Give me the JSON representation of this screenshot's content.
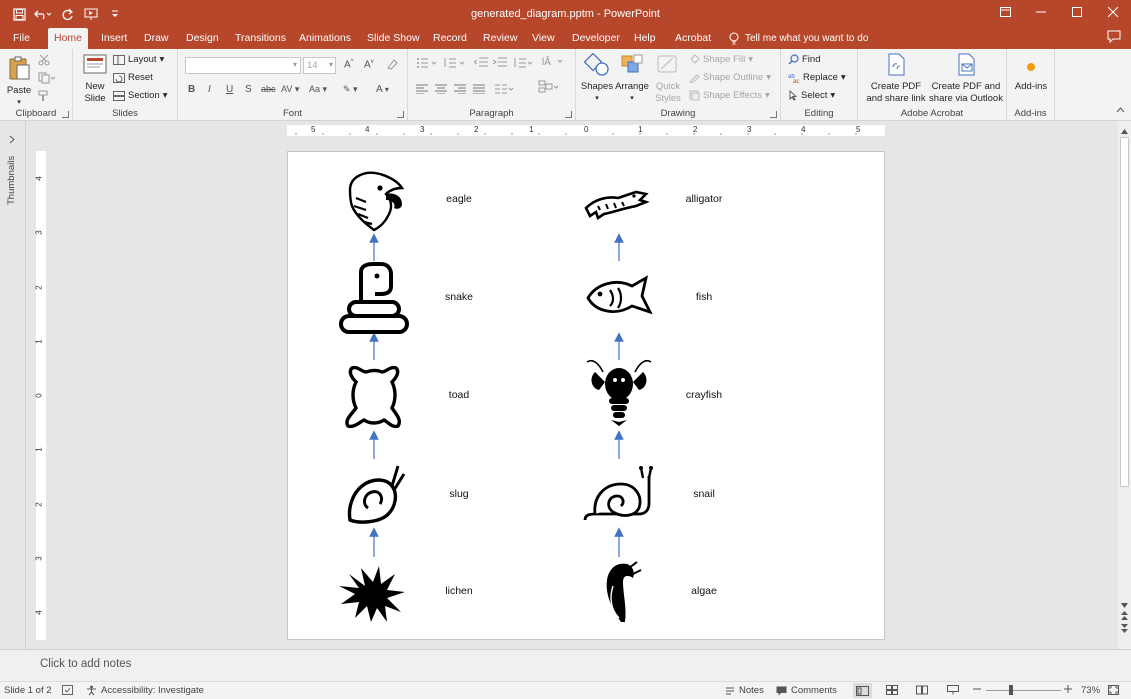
{
  "titlebar": {
    "document_title": "generated_diagram.pptm - PowerPoint"
  },
  "tabs": [
    "File",
    "Home",
    "Insert",
    "Draw",
    "Design",
    "Transitions",
    "Animations",
    "Slide Show",
    "Record",
    "Review",
    "View",
    "Developer",
    "Help",
    "Acrobat"
  ],
  "active_tab": "Home",
  "tell_me": "Tell me what you want to do",
  "ribbon": {
    "clipboard": {
      "paste": "Paste",
      "label": "Clipboard"
    },
    "slides": {
      "new_slide": "New Slide",
      "layout": "Layout",
      "reset": "Reset",
      "section": "Section",
      "label": "Slides"
    },
    "font": {
      "size": "14",
      "label": "Font"
    },
    "paragraph": {
      "label": "Paragraph"
    },
    "drawing": {
      "shapes": "Shapes",
      "arrange": "Arrange",
      "quick_styles": "Quick Styles",
      "shape_fill": "Shape Fill",
      "shape_outline": "Shape Outline",
      "shape_effects": "Shape Effects",
      "label": "Drawing"
    },
    "editing": {
      "find": "Find",
      "replace": "Replace",
      "select": "Select",
      "label": "Editing"
    },
    "acrobat": {
      "create_pdf_link": "Create PDF and share link",
      "create_pdf_outlook": "Create PDF and share via Outlook",
      "label": "Adobe Acrobat"
    },
    "addins": {
      "addins": "Add-ins",
      "label": "Add-ins"
    }
  },
  "thumbnails_label": "Thumbnails",
  "hruler_ticks": [
    "5",
    "4",
    "3",
    "2",
    "1",
    "0",
    "1",
    "2",
    "3",
    "4",
    "5"
  ],
  "vruler_ticks": [
    "4",
    "3",
    "2",
    "1",
    "0",
    "1",
    "2",
    "3",
    "4"
  ],
  "diagram": {
    "left_column": [
      "eagle",
      "snake",
      "toad",
      "slug",
      "lichen"
    ],
    "right_column": [
      "alligator",
      "fish",
      "crayfish",
      "snail",
      "algae"
    ]
  },
  "notes_placeholder": "Click to add notes",
  "status": {
    "slide": "Slide 1 of 2",
    "accessibility": "Accessibility: Investigate",
    "notes": "Notes",
    "comments": "Comments",
    "zoom": "73%"
  },
  "colors": {
    "accent": "#b7472a",
    "arrow": "#4472c4"
  }
}
